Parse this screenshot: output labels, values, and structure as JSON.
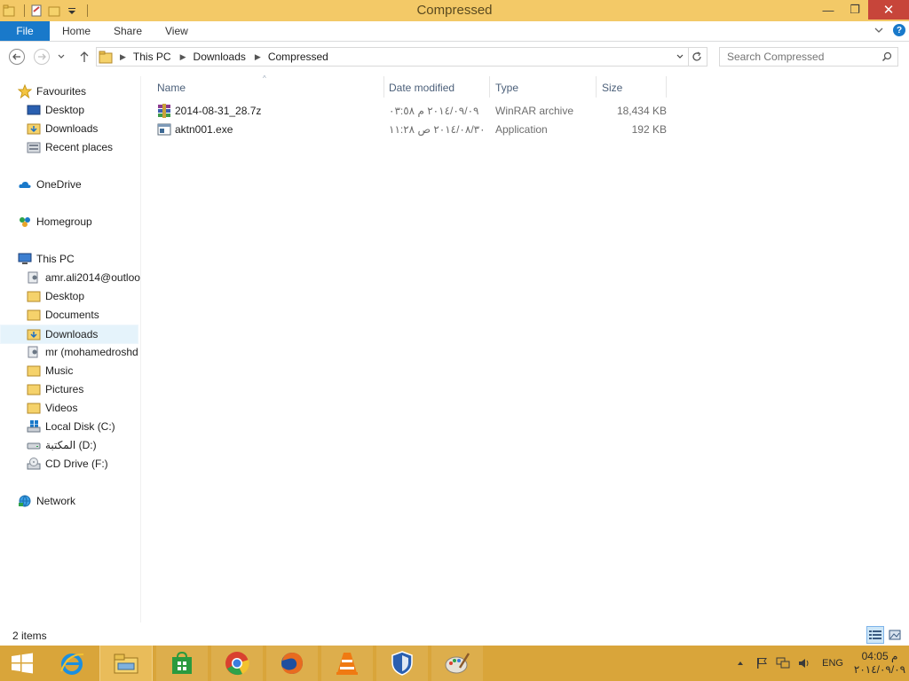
{
  "window": {
    "title": "Compressed",
    "minimize_glyph": "—",
    "maximize_glyph": "❐",
    "close_glyph": "✕"
  },
  "ribbon": {
    "tabs": [
      "File",
      "Home",
      "Share",
      "View"
    ],
    "help_glyph": "?"
  },
  "address": {
    "crumbs": [
      "This PC",
      "Downloads",
      "Compressed"
    ]
  },
  "search": {
    "placeholder": "Search Compressed"
  },
  "navpane": {
    "items": [
      {
        "label": "Favourites",
        "icon": "star-icon"
      },
      {
        "label": "Desktop",
        "icon": "desktop-icon"
      },
      {
        "label": "Downloads",
        "icon": "downloads-folder-icon"
      },
      {
        "label": "Recent places",
        "icon": "recent-places-icon"
      },
      {
        "label": "OneDrive",
        "icon": "onedrive-icon"
      },
      {
        "label": "Homegroup",
        "icon": "homegroup-icon"
      },
      {
        "label": "This PC",
        "icon": "computer-icon"
      },
      {
        "label": "amr.ali2014@outloo",
        "icon": "user-folder-icon"
      },
      {
        "label": "Desktop",
        "icon": "folder-icon"
      },
      {
        "label": "Documents",
        "icon": "folder-icon"
      },
      {
        "label": "Downloads",
        "icon": "downloads-folder-icon"
      },
      {
        "label": "mr (mohamedroshd",
        "icon": "user-folder-icon"
      },
      {
        "label": "Music",
        "icon": "folder-icon"
      },
      {
        "label": "Pictures",
        "icon": "folder-icon"
      },
      {
        "label": "Videos",
        "icon": "folder-icon"
      },
      {
        "label": "Local Disk (C:)",
        "icon": "windows-drive-icon"
      },
      {
        "label": "المكتبة (D:)",
        "icon": "drive-icon"
      },
      {
        "label": "CD Drive (F:)",
        "icon": "cd-drive-icon"
      },
      {
        "label": "Network",
        "icon": "network-icon"
      }
    ],
    "selected": "Downloads"
  },
  "columns": {
    "name": "Name",
    "date": "Date modified",
    "type": "Type",
    "size": "Size"
  },
  "files": [
    {
      "name": "2014-08-31_28.7z",
      "date": "٢٠١٤/٠٩/٠٩ م ٠٣:٥٨",
      "type": "WinRAR archive",
      "size": "18,434 KB",
      "icon": "winrar-archive-icon"
    },
    {
      "name": "aktn001.exe",
      "date": "٢٠١٤/٠٨/٣٠ ص ١١:٢٨",
      "type": "Application",
      "size": "192 KB",
      "icon": "application-icon"
    }
  ],
  "status": {
    "item_count": "2 items"
  },
  "taskbar": {
    "apps": [
      "internet-explorer-icon",
      "file-explorer-icon",
      "store-icon",
      "chrome-icon",
      "firefox-icon",
      "vlc-icon",
      "security-shield-icon",
      "paint-icon"
    ],
    "language": "ENG",
    "clock_time": "م 04:05",
    "clock_date": "٢٠١٤/٠٩/٠٩"
  }
}
